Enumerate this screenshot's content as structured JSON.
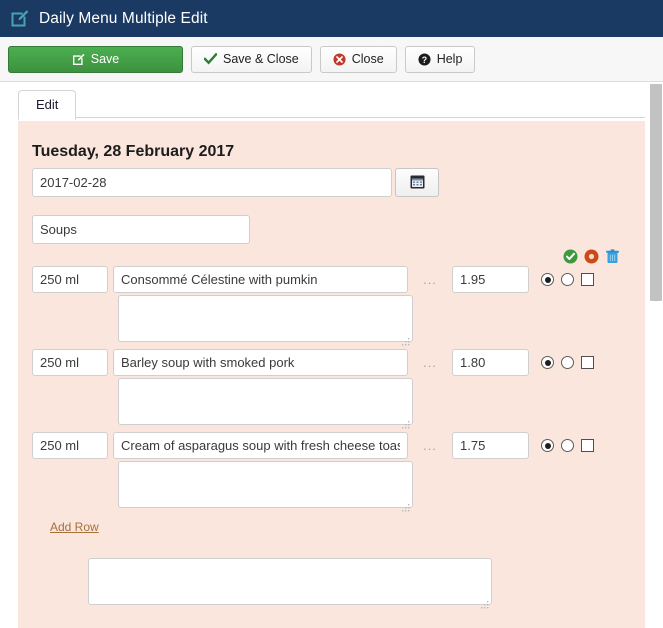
{
  "window": {
    "title": "Daily Menu Multiple Edit",
    "title_icon": "edit-pencil-square-icon",
    "header_color": "#1b3a63"
  },
  "toolbar": {
    "buttons": [
      {
        "label": "Save",
        "icon": "edit-pencil-square-icon",
        "style": "primary-green",
        "color": "#409a43"
      },
      {
        "label": "Save & Close",
        "icon": "checkmark-icon",
        "style": "default",
        "color": "#2e7d32"
      },
      {
        "label": "Close",
        "icon": "close-circle-icon",
        "style": "default",
        "color": "#c0392b"
      },
      {
        "label": "Help",
        "icon": "question-circle-icon",
        "style": "default",
        "color": "#1c1c1c"
      }
    ]
  },
  "tabs": [
    {
      "label": "Edit",
      "active": true
    }
  ],
  "panel": {
    "background_color": "#fbe6dd",
    "day_heading": "Tuesday, 28 February 2017",
    "date_field": {
      "value": "2017-02-28",
      "placeholder": "",
      "picker_icon": "calendar-icon"
    },
    "group_field": {
      "value": "Soups",
      "placeholder": ""
    },
    "row_tools": [
      {
        "name": "confirm-icon",
        "glyph": "check",
        "color": "#3c9a3c"
      },
      {
        "name": "cancel-icon",
        "glyph": "dot",
        "color": "#cc4a17"
      },
      {
        "name": "delete-icon",
        "glyph": "trash",
        "color": "#3aa0dd"
      }
    ],
    "items": [
      {
        "quantity": "250 ml",
        "name": "Consommé Célestine with pumkin",
        "separator": "...",
        "price": "1.95",
        "description": "",
        "option_a_selected": true,
        "option_b_selected": false,
        "flag_checked": false
      },
      {
        "quantity": "250 ml",
        "name": "Barley soup with smoked pork",
        "separator": "...",
        "price": "1.80",
        "description": "",
        "option_a_selected": true,
        "option_b_selected": false,
        "flag_checked": false
      },
      {
        "quantity": "250 ml",
        "name": "Cream of asparagus soup with fresh cheese toast",
        "separator": "...",
        "price": "1.75",
        "description": "",
        "option_a_selected": true,
        "option_b_selected": false,
        "flag_checked": false
      }
    ],
    "add_row_label": "Add Row",
    "bottom_note": {
      "value": "",
      "placeholder": ""
    }
  }
}
